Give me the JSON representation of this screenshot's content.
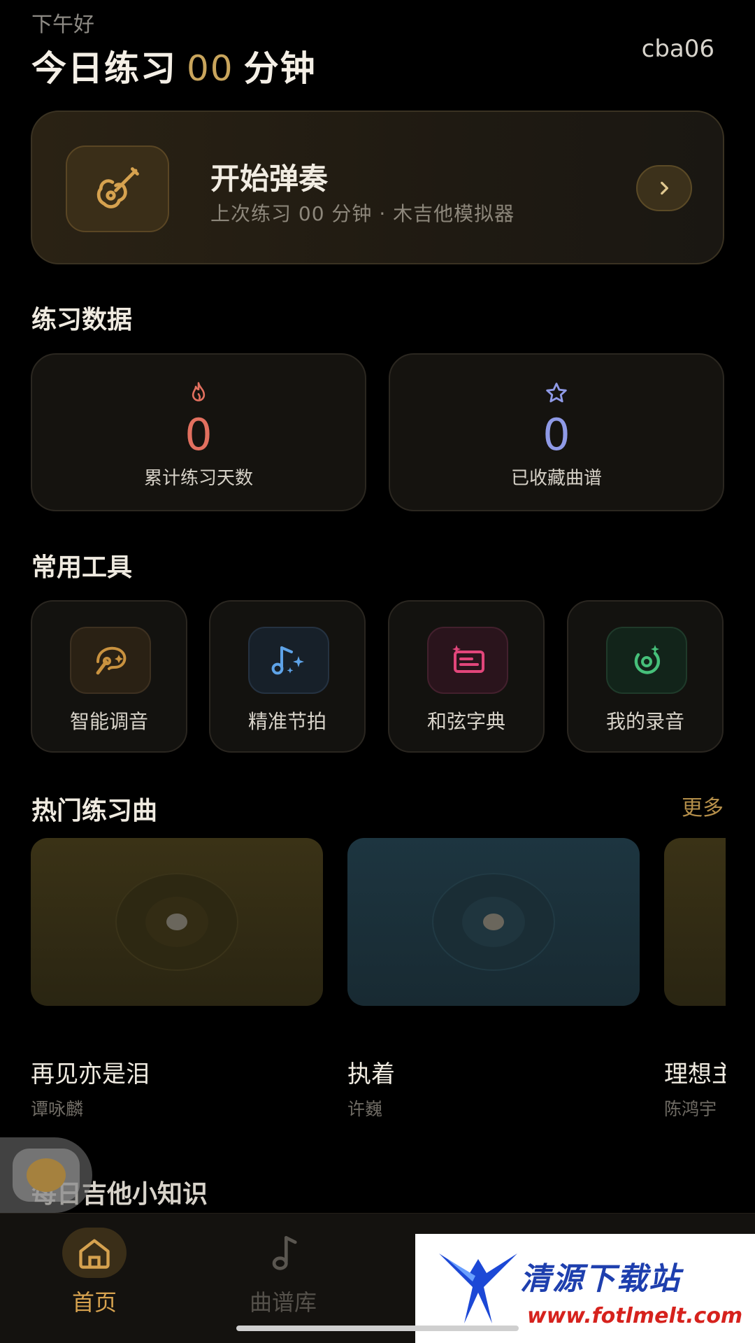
{
  "header": {
    "greeting": "下午好",
    "username": "cba06",
    "headline_prefix": "今日练习",
    "headline_minutes": "00",
    "headline_suffix": "分钟"
  },
  "start_card": {
    "title": "开始弹奏",
    "subtitle": "上次练习 00 分钟 · 木吉他模拟器",
    "icon": "guitar-icon",
    "arrow_icon": "chevron-right-icon"
  },
  "practice_section": {
    "title": "练习数据",
    "stats": [
      {
        "icon": "flame-icon",
        "value": "0",
        "label": "累计练习天数",
        "color": "#e2705f"
      },
      {
        "icon": "star-icon",
        "value": "0",
        "label": "已收藏曲谱",
        "color": "#8f9ae6"
      }
    ]
  },
  "tools_section": {
    "title": "常用工具",
    "tools": [
      {
        "label": "智能调音",
        "icon": "tuner-icon",
        "color": "#c9923f"
      },
      {
        "label": "精准节拍",
        "icon": "music-note-sparkle-icon",
        "color": "#5ea3e8"
      },
      {
        "label": "和弦字典",
        "icon": "chord-card-icon",
        "color": "#e2467b"
      },
      {
        "label": "我的录音",
        "icon": "record-icon",
        "color": "#46c07a"
      }
    ]
  },
  "hot_section": {
    "title": "热门练习曲",
    "more": "更多",
    "songs": [
      {
        "title": "再见亦是泪",
        "artist": "谭咏麟"
      },
      {
        "title": "执着",
        "artist": "许巍"
      },
      {
        "title": "理想主",
        "artist": "陈鸿宇"
      }
    ]
  },
  "tips_section": {
    "title": "每日吉他小知识"
  },
  "tabbar": {
    "tabs": [
      {
        "label": "首页",
        "icon": "home-icon",
        "active": true
      },
      {
        "label": "曲谱库",
        "icon": "music-note-icon",
        "active": false
      }
    ]
  },
  "watermark": {
    "text": "清源下载站",
    "url": "www.fotlmelt.com"
  },
  "colors": {
    "accent": "#c9a55c",
    "background": "#000000"
  }
}
